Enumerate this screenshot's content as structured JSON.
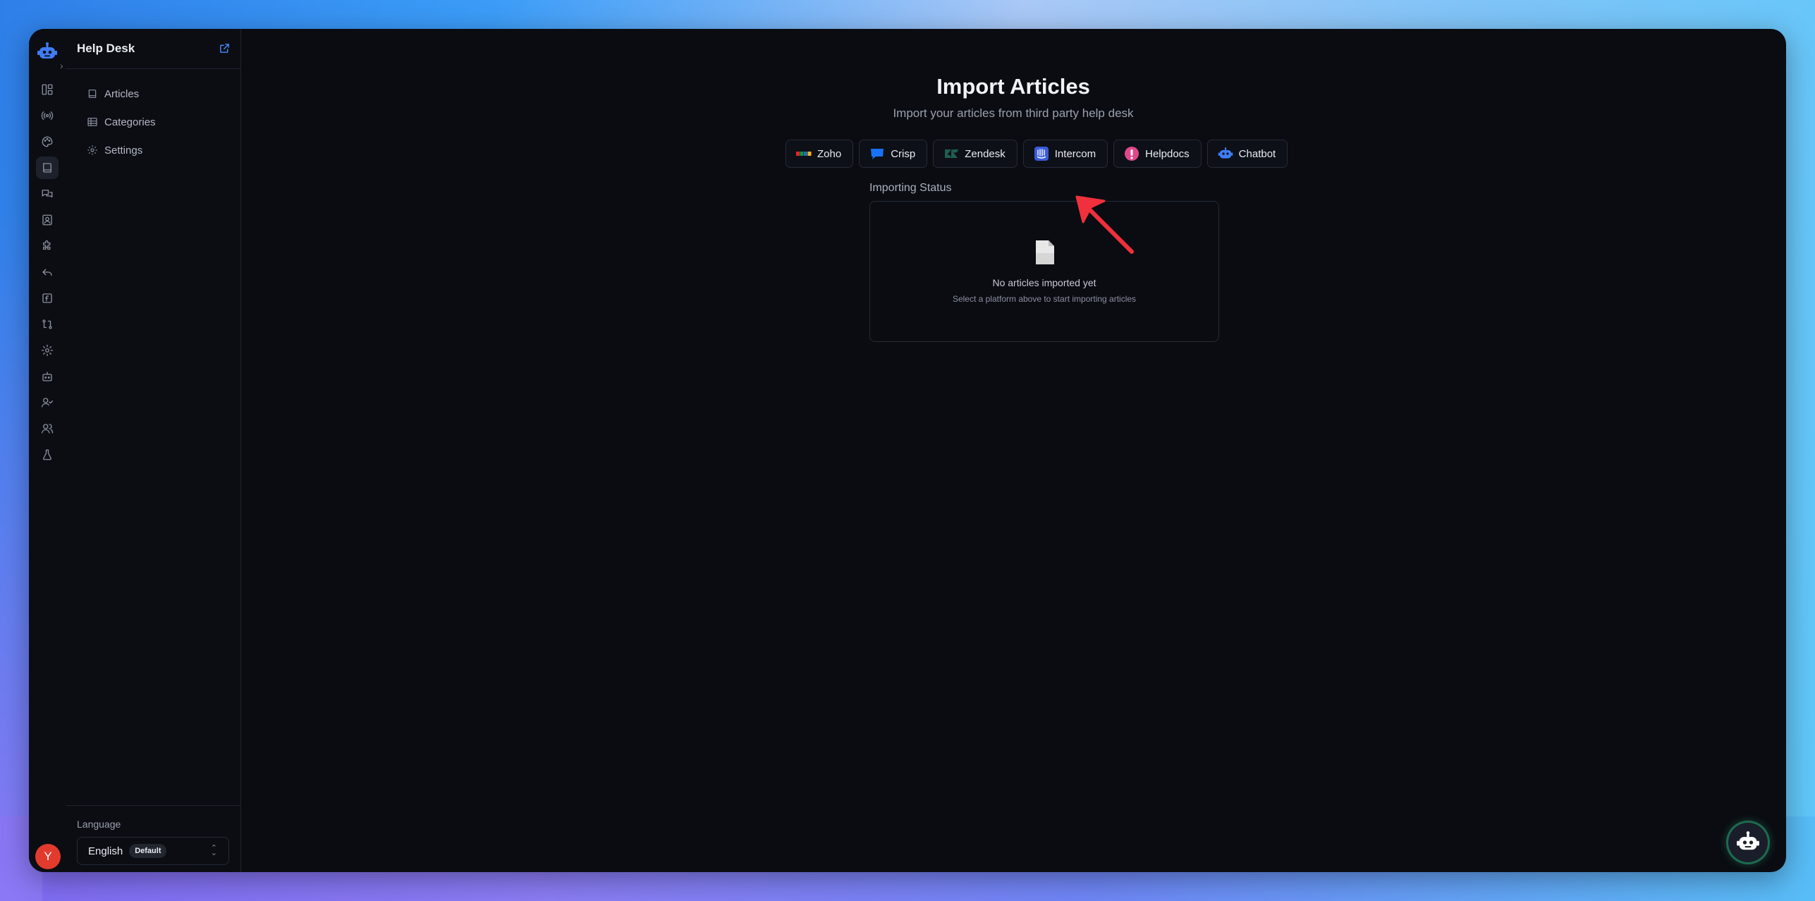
{
  "sidebar": {
    "title": "Help Desk",
    "nav": [
      {
        "label": "Articles",
        "icon": "book-icon"
      },
      {
        "label": "Categories",
        "icon": "table-icon"
      },
      {
        "label": "Settings",
        "icon": "gear-icon"
      }
    ],
    "language": {
      "label": "Language",
      "value": "English",
      "badge": "Default"
    }
  },
  "user": {
    "initial": "Y"
  },
  "main": {
    "title": "Import Articles",
    "subtitle": "Import your articles from third party help desk",
    "platforms": [
      {
        "label": "Zoho",
        "icon": "zoho-logo-icon"
      },
      {
        "label": "Crisp",
        "icon": "crisp-logo-icon"
      },
      {
        "label": "Zendesk",
        "icon": "zendesk-logo-icon"
      },
      {
        "label": "Intercom",
        "icon": "intercom-logo-icon"
      },
      {
        "label": "Helpdocs",
        "icon": "helpdocs-logo-icon"
      },
      {
        "label": "Chatbot",
        "icon": "chatbot-logo-icon"
      }
    ],
    "status": {
      "label": "Importing Status",
      "empty_title": "No articles imported yet",
      "empty_subtitle": "Select a platform above to start importing articles"
    }
  },
  "colors": {
    "accent": "#3f8cff",
    "background": "#0a0c12",
    "annotation_arrow": "#f0303c"
  }
}
